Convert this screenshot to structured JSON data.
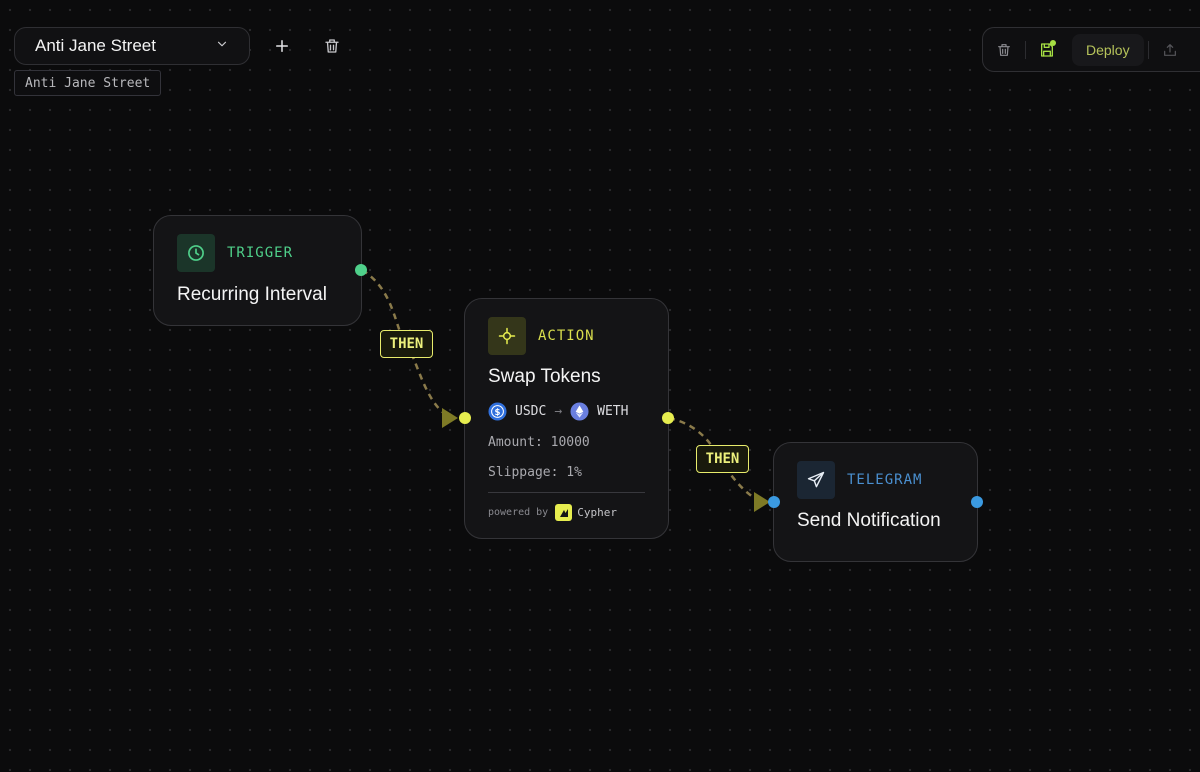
{
  "header": {
    "workflow_name": "Anti Jane Street",
    "workflow_tag": "Anti Jane Street",
    "add_label": "+"
  },
  "toolbar": {
    "deploy_label": "Deploy"
  },
  "nodes": {
    "trigger": {
      "type": "TRIGGER",
      "title": "Recurring Interval",
      "icon": "clock-icon"
    },
    "action": {
      "type": "ACTION",
      "title": "Swap Tokens",
      "icon": "crosshair-icon",
      "from_token": "USDC",
      "arrow": "→",
      "to_token": "WETH",
      "amount": "Amount: 10000",
      "slippage": "Slippage: 1%",
      "powered_by": "powered by",
      "provider": "Cypher"
    },
    "telegram": {
      "type": "TELEGRAM",
      "title": "Send Notification",
      "icon": "send-icon"
    }
  },
  "edges": [
    {
      "label": "THEN"
    },
    {
      "label": "THEN"
    }
  ],
  "colors": {
    "trigger": "#4fd08a",
    "action": "#e6ed4f",
    "telegram": "#3b9ae1",
    "edge": "#8a7a4a"
  }
}
